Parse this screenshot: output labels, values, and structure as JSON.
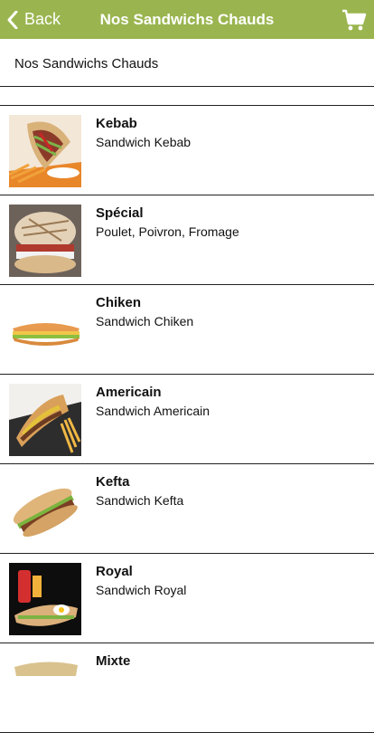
{
  "nav": {
    "back_label": "Back",
    "title": "Nos Sandwichs Chauds",
    "back_icon": "chevron-left-icon",
    "cart_icon": "cart-icon"
  },
  "section": {
    "title": "Nos Sandwichs Chauds"
  },
  "colors": {
    "nav_background": "#9ab54f",
    "nav_text": "#ffffff"
  },
  "items": [
    {
      "name": "Kebab",
      "description": "Sandwich Kebab",
      "image": "kebab-photo"
    },
    {
      "name": "Spécial",
      "description": "Poulet, Poivron, Fromage",
      "image": "special-burger-photo"
    },
    {
      "name": "Chiken",
      "description": "Sandwich Chiken",
      "image": "chicken-sub-photo"
    },
    {
      "name": "Americain",
      "description": "Sandwich Americain",
      "image": "americain-photo"
    },
    {
      "name": "Kefta",
      "description": "Sandwich Kefta",
      "image": "kefta-photo"
    },
    {
      "name": "Royal",
      "description": "Sandwich Royal",
      "image": "royal-menu-photo"
    },
    {
      "name": "Mixte",
      "description": "",
      "image": "mixte-photo"
    }
  ]
}
